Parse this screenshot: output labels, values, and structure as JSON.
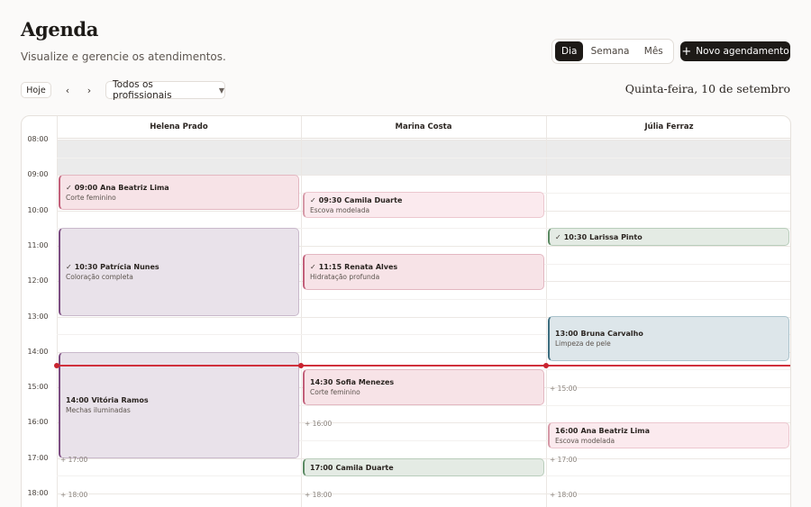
{
  "header": {
    "title": "Agenda",
    "subtitle": "Visualize e gerencie os atendimentos.",
    "views": [
      "Dia",
      "Semana",
      "Mês"
    ],
    "active_view": "Dia",
    "new_button": "Novo agendamento"
  },
  "toolbar": {
    "today": "Hoje",
    "prev": "‹",
    "next": "›",
    "professional_filter": "Todos os profissionais",
    "date": "Quinta-feira, 10 de setembro"
  },
  "calendar": {
    "hours": [
      "08:00",
      "09:00",
      "10:00",
      "11:00",
      "12:00",
      "13:00",
      "14:00",
      "15:00",
      "16:00",
      "17:00",
      "18:00"
    ],
    "current_time": "14:25",
    "columns": [
      {
        "name": "Helena Prado",
        "events": [
          {
            "time": "09:00",
            "client": "Ana Beatriz Lima",
            "service": "Corte feminino",
            "confirmed": true,
            "color": "#c2607a"
          },
          {
            "time": "10:30",
            "client": "Patrícia Nunes",
            "service": "Coloração completa",
            "confirmed": true,
            "color": "#7c4d82"
          },
          {
            "time": "14:00",
            "client": "Vitória Ramos",
            "service": "Mechas iluminadas",
            "confirmed": false,
            "color": "#7c4d82"
          }
        ],
        "free_slots": [
          "+ 17:00",
          "+ 18:00"
        ]
      },
      {
        "name": "Marina Costa",
        "events": [
          {
            "time": "09:30",
            "client": "Camila Duarte",
            "service": "Escova modelada",
            "confirmed": true,
            "color": "#d69aa8"
          },
          {
            "time": "11:15",
            "client": "Renata Alves",
            "service": "Hidratação profunda",
            "confirmed": true,
            "color": "#c2607a"
          },
          {
            "time": "14:30",
            "client": "Sofia Menezes",
            "service": "Corte feminino",
            "confirmed": false,
            "color": "#c2607a"
          },
          {
            "time": "17:00",
            "client": "Camila Duarte",
            "service": "",
            "confirmed": false,
            "color": "#5b8a63"
          }
        ],
        "free_slots": [
          "+ 16:00",
          "+ 18:00"
        ]
      },
      {
        "name": "Júlia Ferraz",
        "events": [
          {
            "time": "10:30",
            "client": "Larissa Pinto",
            "service": "",
            "confirmed": true,
            "color": "#5b8a63"
          },
          {
            "time": "13:00",
            "client": "Bruna Carvalho",
            "service": "Limpeza de pele",
            "confirmed": false,
            "color": "#3d6e80"
          },
          {
            "time": "16:00",
            "client": "Ana Beatriz Lima",
            "service": "Escova modelada",
            "confirmed": false,
            "color": "#d69aa8"
          }
        ],
        "free_slots": [
          "+ 15:00",
          "+ 17:00",
          "+ 18:00"
        ]
      }
    ]
  }
}
